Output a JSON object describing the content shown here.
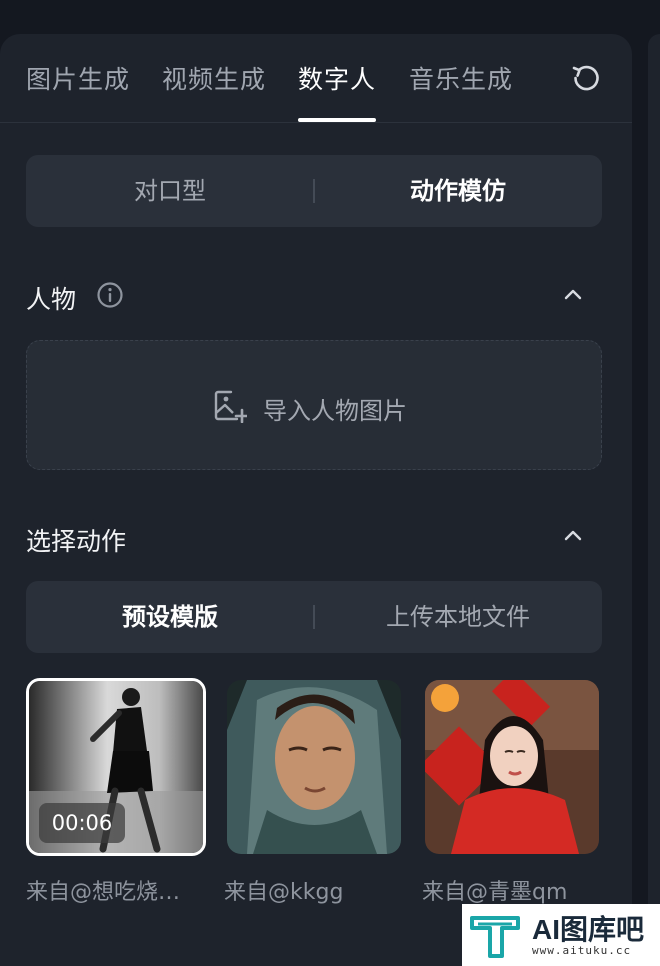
{
  "tabs": [
    {
      "label": "图片生成",
      "active": false
    },
    {
      "label": "视频生成",
      "active": false
    },
    {
      "label": "数字人",
      "active": true
    },
    {
      "label": "音乐生成",
      "active": false
    }
  ],
  "mode_segment": {
    "left": "对口型",
    "right": "动作模仿",
    "selected": "动作模仿"
  },
  "person_section": {
    "title": "人物",
    "upload_label": "导入人物图片"
  },
  "action_section": {
    "title": "选择动作",
    "segment": {
      "left": "预设模版",
      "right": "上传本地文件",
      "selected": "预设模版"
    }
  },
  "templates": [
    {
      "caption": "来自@想吃烧…",
      "duration": "00:06",
      "selected": true
    },
    {
      "caption": "来自@kkgg",
      "duration": "",
      "selected": false
    },
    {
      "caption": "来自@青墨qm",
      "duration": "",
      "selected": false
    }
  ],
  "watermark": {
    "text": "AI图库吧",
    "url": "www.aituku.cc"
  },
  "icons": {
    "refresh": "refresh-icon",
    "info": "info-icon",
    "chevron": "chevron-up-icon",
    "upload": "image-add-icon"
  },
  "colors": {
    "background": "#141820",
    "panel": "#1e232c",
    "segment": "#2a303a",
    "active_text": "#ffffff",
    "muted_text": "#a3a8b1"
  }
}
